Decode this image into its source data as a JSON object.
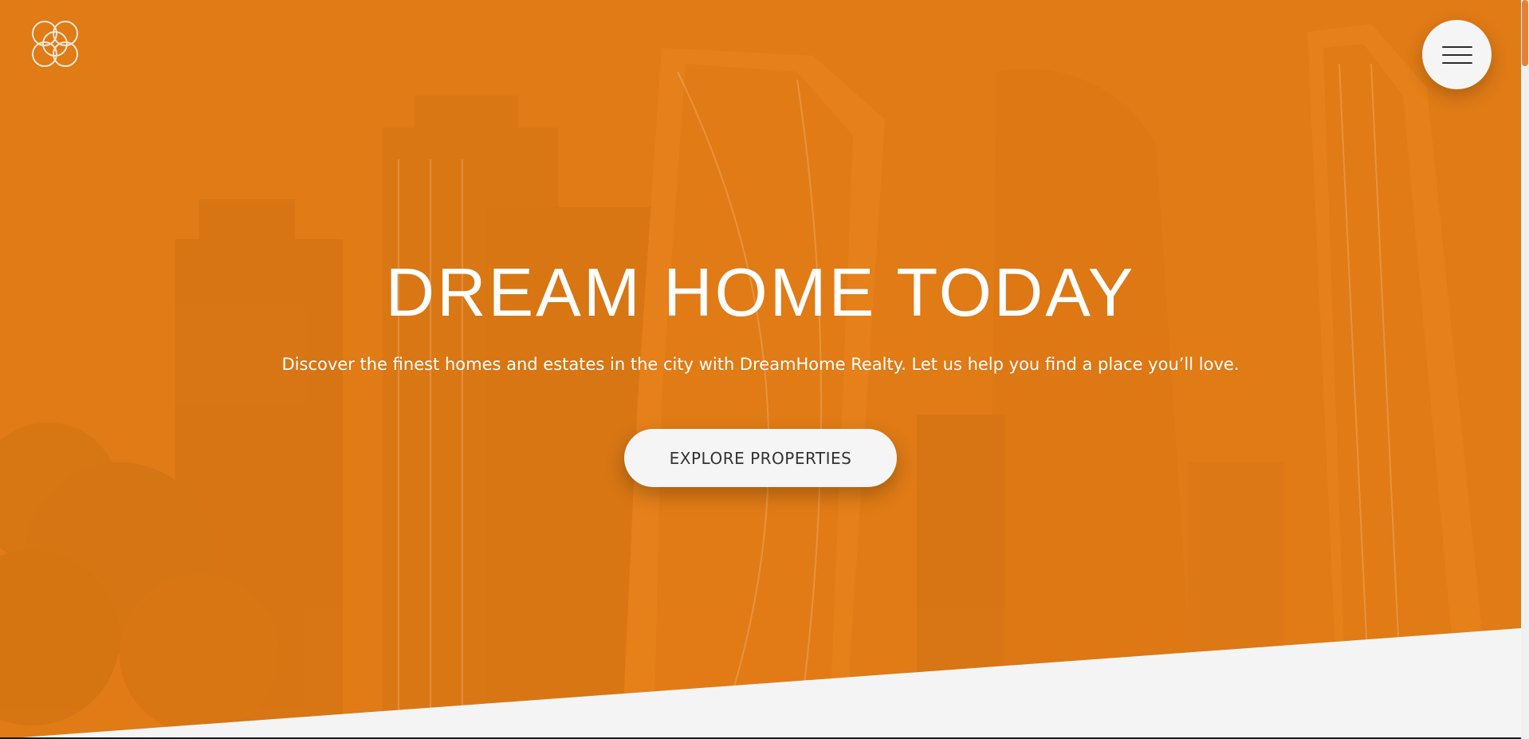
{
  "brand": {
    "logo_icon": "four-rings-logo-icon"
  },
  "header": {
    "menu_icon": "hamburger-menu-icon"
  },
  "hero": {
    "title": "DREAM HOME TODAY",
    "subtitle": "Discover the finest homes and estates in the city with DreamHome Realty. Let us help you find a place you’ll love.",
    "cta_label": "EXPLORE PROPERTIES",
    "background_image": "city-skyscrapers-photo"
  },
  "colors": {
    "accent": "#e07b16",
    "button_bg": "#f5f5f5",
    "page_bg": "#f4f4f4",
    "text_light": "#ffffff",
    "button_text": "#333333"
  }
}
